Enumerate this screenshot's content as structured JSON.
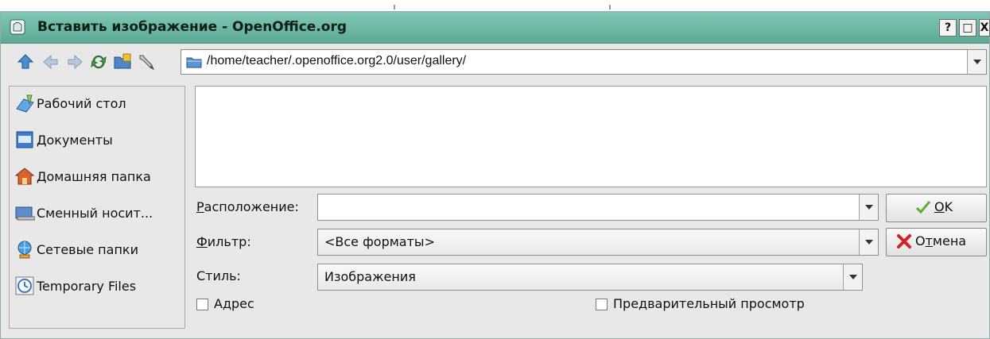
{
  "window": {
    "title": "Вставить изображение - OpenOffice.org",
    "controls": {
      "help": "?",
      "maximize": "□",
      "close": "X"
    }
  },
  "toolbar": {
    "icons": [
      "up-arrow-icon",
      "back-arrow-icon",
      "forward-arrow-icon",
      "reload-icon",
      "new-folder-icon",
      "settings-wrench-icon"
    ],
    "path": "/home/teacher/.openoffice.org2.0/user/gallery/"
  },
  "sidebar": {
    "items": [
      {
        "label": "Рабочий стол",
        "icon": "desktop-icon"
      },
      {
        "label": "Документы",
        "icon": "documents-icon"
      },
      {
        "label": "Домашняя папка",
        "icon": "home-icon"
      },
      {
        "label": "Сменный носит...",
        "icon": "removable-media-icon"
      },
      {
        "label": "Сетевые папки",
        "icon": "network-folders-icon"
      },
      {
        "label": "Temporary Files",
        "icon": "clock-icon"
      }
    ]
  },
  "form": {
    "location_label_mnemonic": "Р",
    "location_label_rest": "асположение:",
    "location_value": "",
    "filter_label_mnemonic": "Ф",
    "filter_label_rest": "ильтр:",
    "filter_value": "<Все форматы>",
    "style_label": "Стиль:",
    "style_value": "Изображения"
  },
  "buttons": {
    "ok_mnemonic": "O",
    "ok_rest": "K",
    "cancel_pre": "О",
    "cancel_mnemonic": "т",
    "cancel_rest": "мена"
  },
  "checkboxes": {
    "address": {
      "label": "Адрес",
      "checked": false
    },
    "preview": {
      "label": "Предварительный просмотр",
      "checked": false
    }
  },
  "colors": {
    "titlebar": "#6fb8a6",
    "ok_check": "#58b030",
    "cancel_x": "#d42020"
  }
}
